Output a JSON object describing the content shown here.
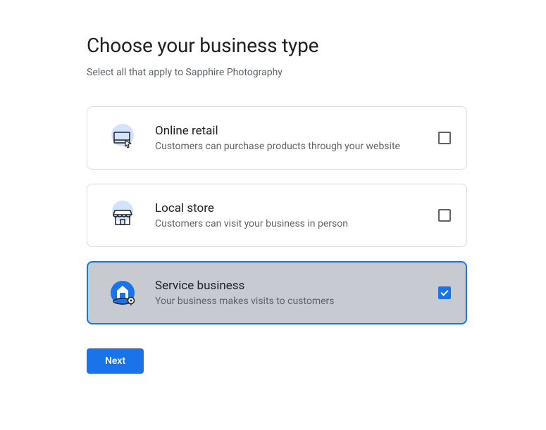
{
  "title": "Choose your business type",
  "subtitle": "Select all that apply to Sapphire Photography",
  "options": [
    {
      "title": "Online retail",
      "description": "Customers can purchase products through your website",
      "selected": false,
      "icon": "monitor-click"
    },
    {
      "title": "Local store",
      "description": "Customers can visit your business in person",
      "selected": false,
      "icon": "storefront"
    },
    {
      "title": "Service business",
      "description": "Your business makes visits to customers",
      "selected": true,
      "icon": "house-pin"
    }
  ],
  "next_label": "Next"
}
